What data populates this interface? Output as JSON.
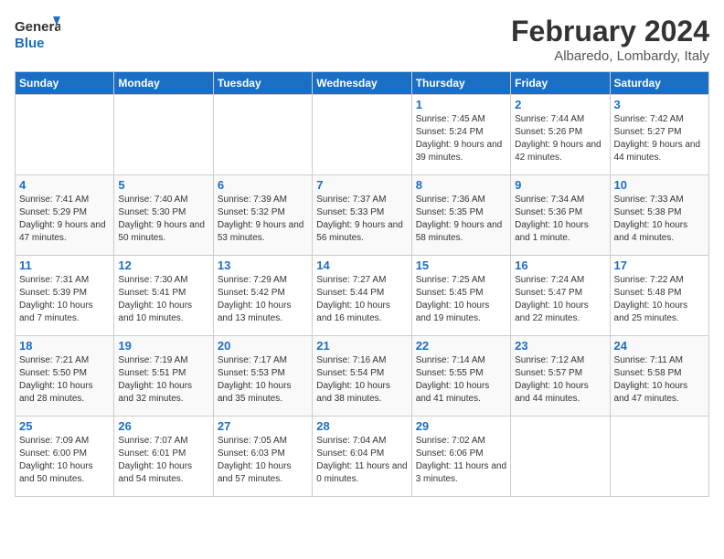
{
  "header": {
    "logo_line1": "General",
    "logo_line2": "Blue",
    "month": "February 2024",
    "location": "Albaredo, Lombardy, Italy"
  },
  "weekdays": [
    "Sunday",
    "Monday",
    "Tuesday",
    "Wednesday",
    "Thursday",
    "Friday",
    "Saturday"
  ],
  "weeks": [
    [
      {
        "day": "",
        "info": ""
      },
      {
        "day": "",
        "info": ""
      },
      {
        "day": "",
        "info": ""
      },
      {
        "day": "",
        "info": ""
      },
      {
        "day": "1",
        "info": "Sunrise: 7:45 AM\nSunset: 5:24 PM\nDaylight: 9 hours\nand 39 minutes."
      },
      {
        "day": "2",
        "info": "Sunrise: 7:44 AM\nSunset: 5:26 PM\nDaylight: 9 hours\nand 42 minutes."
      },
      {
        "day": "3",
        "info": "Sunrise: 7:42 AM\nSunset: 5:27 PM\nDaylight: 9 hours\nand 44 minutes."
      }
    ],
    [
      {
        "day": "4",
        "info": "Sunrise: 7:41 AM\nSunset: 5:29 PM\nDaylight: 9 hours\nand 47 minutes."
      },
      {
        "day": "5",
        "info": "Sunrise: 7:40 AM\nSunset: 5:30 PM\nDaylight: 9 hours\nand 50 minutes."
      },
      {
        "day": "6",
        "info": "Sunrise: 7:39 AM\nSunset: 5:32 PM\nDaylight: 9 hours\nand 53 minutes."
      },
      {
        "day": "7",
        "info": "Sunrise: 7:37 AM\nSunset: 5:33 PM\nDaylight: 9 hours\nand 56 minutes."
      },
      {
        "day": "8",
        "info": "Sunrise: 7:36 AM\nSunset: 5:35 PM\nDaylight: 9 hours\nand 58 minutes."
      },
      {
        "day": "9",
        "info": "Sunrise: 7:34 AM\nSunset: 5:36 PM\nDaylight: 10 hours\nand 1 minute."
      },
      {
        "day": "10",
        "info": "Sunrise: 7:33 AM\nSunset: 5:38 PM\nDaylight: 10 hours\nand 4 minutes."
      }
    ],
    [
      {
        "day": "11",
        "info": "Sunrise: 7:31 AM\nSunset: 5:39 PM\nDaylight: 10 hours\nand 7 minutes."
      },
      {
        "day": "12",
        "info": "Sunrise: 7:30 AM\nSunset: 5:41 PM\nDaylight: 10 hours\nand 10 minutes."
      },
      {
        "day": "13",
        "info": "Sunrise: 7:29 AM\nSunset: 5:42 PM\nDaylight: 10 hours\nand 13 minutes."
      },
      {
        "day": "14",
        "info": "Sunrise: 7:27 AM\nSunset: 5:44 PM\nDaylight: 10 hours\nand 16 minutes."
      },
      {
        "day": "15",
        "info": "Sunrise: 7:25 AM\nSunset: 5:45 PM\nDaylight: 10 hours\nand 19 minutes."
      },
      {
        "day": "16",
        "info": "Sunrise: 7:24 AM\nSunset: 5:47 PM\nDaylight: 10 hours\nand 22 minutes."
      },
      {
        "day": "17",
        "info": "Sunrise: 7:22 AM\nSunset: 5:48 PM\nDaylight: 10 hours\nand 25 minutes."
      }
    ],
    [
      {
        "day": "18",
        "info": "Sunrise: 7:21 AM\nSunset: 5:50 PM\nDaylight: 10 hours\nand 28 minutes."
      },
      {
        "day": "19",
        "info": "Sunrise: 7:19 AM\nSunset: 5:51 PM\nDaylight: 10 hours\nand 32 minutes."
      },
      {
        "day": "20",
        "info": "Sunrise: 7:17 AM\nSunset: 5:53 PM\nDaylight: 10 hours\nand 35 minutes."
      },
      {
        "day": "21",
        "info": "Sunrise: 7:16 AM\nSunset: 5:54 PM\nDaylight: 10 hours\nand 38 minutes."
      },
      {
        "day": "22",
        "info": "Sunrise: 7:14 AM\nSunset: 5:55 PM\nDaylight: 10 hours\nand 41 minutes."
      },
      {
        "day": "23",
        "info": "Sunrise: 7:12 AM\nSunset: 5:57 PM\nDaylight: 10 hours\nand 44 minutes."
      },
      {
        "day": "24",
        "info": "Sunrise: 7:11 AM\nSunset: 5:58 PM\nDaylight: 10 hours\nand 47 minutes."
      }
    ],
    [
      {
        "day": "25",
        "info": "Sunrise: 7:09 AM\nSunset: 6:00 PM\nDaylight: 10 hours\nand 50 minutes."
      },
      {
        "day": "26",
        "info": "Sunrise: 7:07 AM\nSunset: 6:01 PM\nDaylight: 10 hours\nand 54 minutes."
      },
      {
        "day": "27",
        "info": "Sunrise: 7:05 AM\nSunset: 6:03 PM\nDaylight: 10 hours\nand 57 minutes."
      },
      {
        "day": "28",
        "info": "Sunrise: 7:04 AM\nSunset: 6:04 PM\nDaylight: 11 hours\nand 0 minutes."
      },
      {
        "day": "29",
        "info": "Sunrise: 7:02 AM\nSunset: 6:06 PM\nDaylight: 11 hours\nand 3 minutes."
      },
      {
        "day": "",
        "info": ""
      },
      {
        "day": "",
        "info": ""
      }
    ]
  ]
}
